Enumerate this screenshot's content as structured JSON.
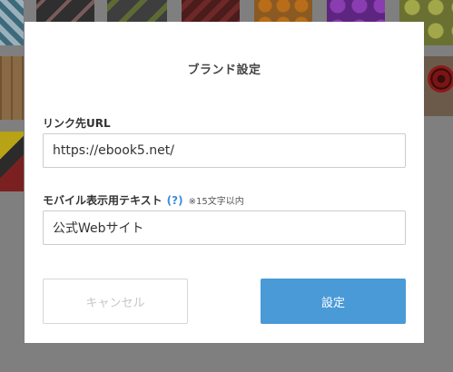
{
  "dialog": {
    "title": "ブランド設定",
    "link_url_label": "リンク先URL",
    "link_url_value": "https://ebook5.net/",
    "mobile_text_label": "モバイル表示用テキスト",
    "help_link": "(?)",
    "mobile_text_hint": "※15文字以内",
    "mobile_text_value": "公式Webサイト",
    "cancel_label": "キャンセル",
    "ok_label": "設定"
  },
  "colors": {
    "accent": "#4a9ad8",
    "help_link": "#3b8fd9",
    "overlay": "#7f7f7f"
  }
}
